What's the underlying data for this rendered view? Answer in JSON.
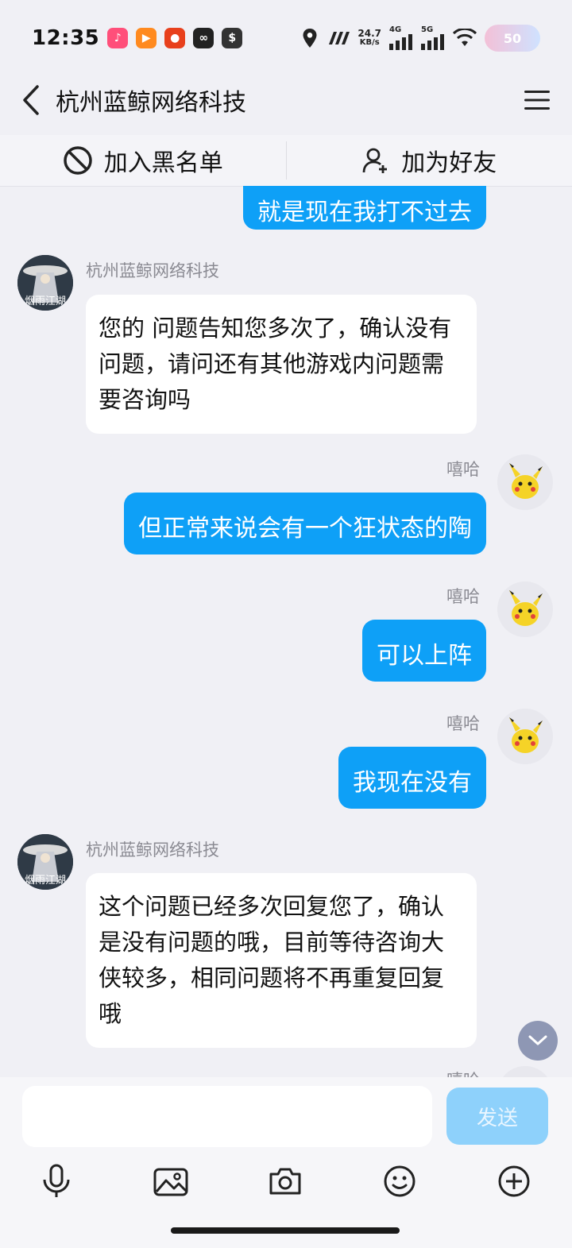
{
  "status_bar": {
    "time": "12:35",
    "net_speed_value": "24.7",
    "net_speed_unit": "KB/s",
    "sig1": "4G",
    "sig2": "5G",
    "battery": "50"
  },
  "header": {
    "title": "杭州蓝鲸网络科技",
    "back_icon": "chevron-left-icon",
    "menu_icon": "hamburger-menu-icon"
  },
  "actions": {
    "block_label": "加入黑名单",
    "add_friend_label": "加为好友"
  },
  "messages": [
    {
      "side": "out",
      "text": "就是现在我打不过去"
    },
    {
      "side": "in",
      "sender": "杭州蓝鲸网络科技",
      "text": "您的 问题告知您多次了，确认没有问题，请问还有其他游戏内问题需要咨询吗"
    },
    {
      "side": "out",
      "sender": "嘻哈",
      "text": "但正常来说会有一个狂状态的陶"
    },
    {
      "side": "out",
      "sender": "嘻哈",
      "text": "可以上阵"
    },
    {
      "side": "out",
      "sender": "嘻哈",
      "text": "我现在没有"
    },
    {
      "side": "in",
      "sender": "杭州蓝鲸网络科技",
      "text": "这个问题已经多次回复您了，确认是没有问题的哦，目前等待咨询大侠较多，相同问题将不再重复回复哦"
    },
    {
      "side": "out",
      "sender": "嘻哈",
      "text": ""
    }
  ],
  "avatar_text": "烟雨江湖",
  "composer": {
    "input_value": "",
    "send_label": "发送"
  },
  "colors": {
    "outgoing_bubble": "#0ea0f7",
    "send_button": "#8ed1fb",
    "background": "#f0f0f5"
  }
}
